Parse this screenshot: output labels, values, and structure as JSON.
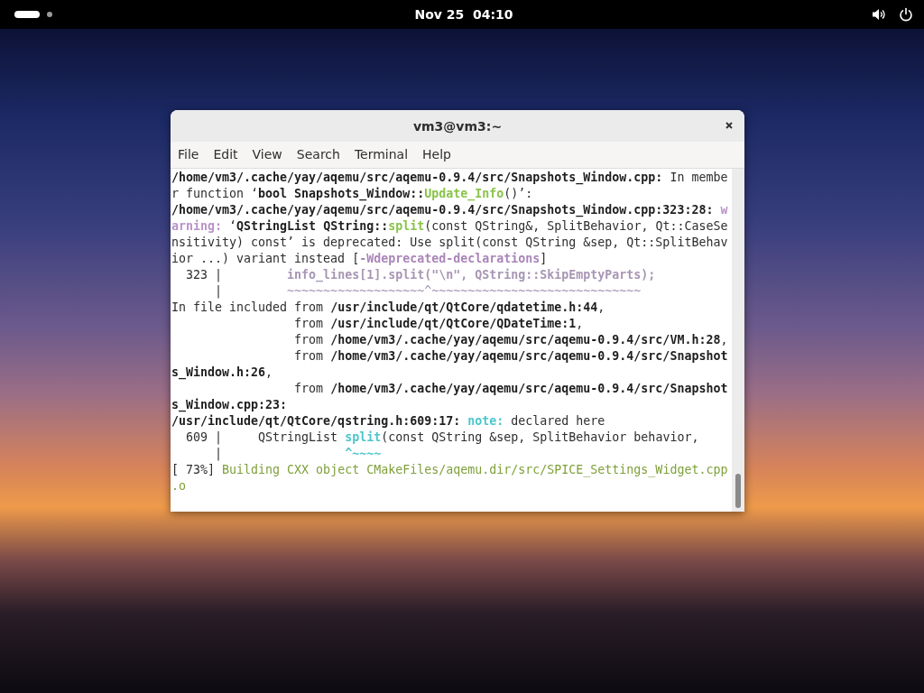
{
  "top_bar": {
    "clock": "Nov 25  04:10"
  },
  "window": {
    "title": "vm3@vm3:~",
    "menu": [
      "File",
      "Edit",
      "View",
      "Search",
      "Terminal",
      "Help"
    ],
    "terminal": {
      "lines": [
        {
          "segments": [
            {
              "kind": "bold",
              "text": "/home/vm3/.cache/yay/aqemu/src/aqemu-0.9.4/src/Snapshots_Window.cpp:"
            },
            {
              "kind": "plain",
              "text": " In membe"
            }
          ]
        },
        {
          "segments": [
            {
              "kind": "plain",
              "text": "r function ‘"
            },
            {
              "kind": "bold",
              "text": "bool Snapshots_Window::"
            },
            {
              "kind": "func",
              "text": "Update_Info"
            },
            {
              "kind": "plain",
              "text": "()’:"
            }
          ]
        },
        {
          "segments": [
            {
              "kind": "bold",
              "text": "/home/vm3/.cache/yay/aqemu/src/aqemu-0.9.4/src/Snapshots_Window.cpp:323:28: "
            },
            {
              "kind": "warning",
              "text": "w"
            }
          ]
        },
        {
          "segments": [
            {
              "kind": "warning",
              "text": "arning:"
            },
            {
              "kind": "plain",
              "text": " ‘"
            },
            {
              "kind": "bold",
              "text": "QStringList QString::"
            },
            {
              "kind": "func",
              "text": "split"
            },
            {
              "kind": "plain",
              "text": "(const QString&, SplitBehavior, Qt::CaseSe"
            }
          ]
        },
        {
          "segments": [
            {
              "kind": "plain",
              "text": "nsitivity) const’ is deprecated: Use split(const QString &sep, Qt::SplitBehav"
            }
          ]
        },
        {
          "segments": [
            {
              "kind": "plain",
              "text": "ior ...) variant instead ["
            },
            {
              "kind": "flag",
              "text": "-Wdeprecated-declarations"
            },
            {
              "kind": "plain",
              "text": "]"
            }
          ]
        },
        {
          "segments": [
            {
              "kind": "plain",
              "text": "  323 | "
            },
            {
              "kind": "source",
              "text": "        info_lines[1].split(\"\\n\", QString::SkipEmptyParts);"
            }
          ]
        },
        {
          "segments": [
            {
              "kind": "plain",
              "text": "      | "
            },
            {
              "kind": "marker",
              "text": "        ~~~~~~~~~~~~~~~~~~~^~~~~~~~~~~~~~~~~~~~~~~~~~~~~~"
            }
          ]
        },
        {
          "segments": [
            {
              "kind": "plain",
              "text": "In file included from "
            },
            {
              "kind": "bold",
              "text": "/usr/include/qt/QtCore/qdatetime.h:44"
            },
            {
              "kind": "plain",
              "text": ","
            }
          ]
        },
        {
          "segments": [
            {
              "kind": "plain",
              "text": "                 from "
            },
            {
              "kind": "bold",
              "text": "/usr/include/qt/QtCore/QDateTime:1"
            },
            {
              "kind": "plain",
              "text": ","
            }
          ]
        },
        {
          "segments": [
            {
              "kind": "plain",
              "text": "                 from "
            },
            {
              "kind": "bold",
              "text": "/home/vm3/.cache/yay/aqemu/src/aqemu-0.9.4/src/VM.h:28"
            },
            {
              "kind": "plain",
              "text": ","
            }
          ]
        },
        {
          "segments": [
            {
              "kind": "plain",
              "text": "                 from "
            },
            {
              "kind": "bold",
              "text": "/home/vm3/.cache/yay/aqemu/src/aqemu-0.9.4/src/Snapshot"
            }
          ]
        },
        {
          "segments": [
            {
              "kind": "bold",
              "text": "s_Window.h:26"
            },
            {
              "kind": "plain",
              "text": ","
            }
          ]
        },
        {
          "segments": [
            {
              "kind": "plain",
              "text": "                 from "
            },
            {
              "kind": "bold",
              "text": "/home/vm3/.cache/yay/aqemu/src/aqemu-0.9.4/src/Snapshot"
            }
          ]
        },
        {
          "segments": [
            {
              "kind": "bold",
              "text": "s_Window.cpp:23:"
            }
          ]
        },
        {
          "segments": [
            {
              "kind": "bold",
              "text": "/usr/include/qt/QtCore/qstring.h:609:17: "
            },
            {
              "kind": "note",
              "text": "note:"
            },
            {
              "kind": "plain",
              "text": " declared here"
            }
          ]
        },
        {
          "segments": [
            {
              "kind": "plain",
              "text": "  609 |     QStringList "
            },
            {
              "kind": "note",
              "text": "split"
            },
            {
              "kind": "plain",
              "text": "(const QString &sep, SplitBehavior behavior,"
            }
          ]
        },
        {
          "segments": [
            {
              "kind": "plain",
              "text": "      |                 "
            },
            {
              "kind": "note",
              "text": "^~~~~"
            }
          ]
        },
        {
          "segments": [
            {
              "kind": "plain",
              "text": "[ 73%] "
            },
            {
              "kind": "progress",
              "text": "Building CXX object CMakeFiles/aqemu.dir/src/SPICE_Settings_Widget.cpp"
            }
          ]
        },
        {
          "segments": [
            {
              "kind": "progress",
              "text": ".o"
            }
          ]
        }
      ]
    }
  }
}
